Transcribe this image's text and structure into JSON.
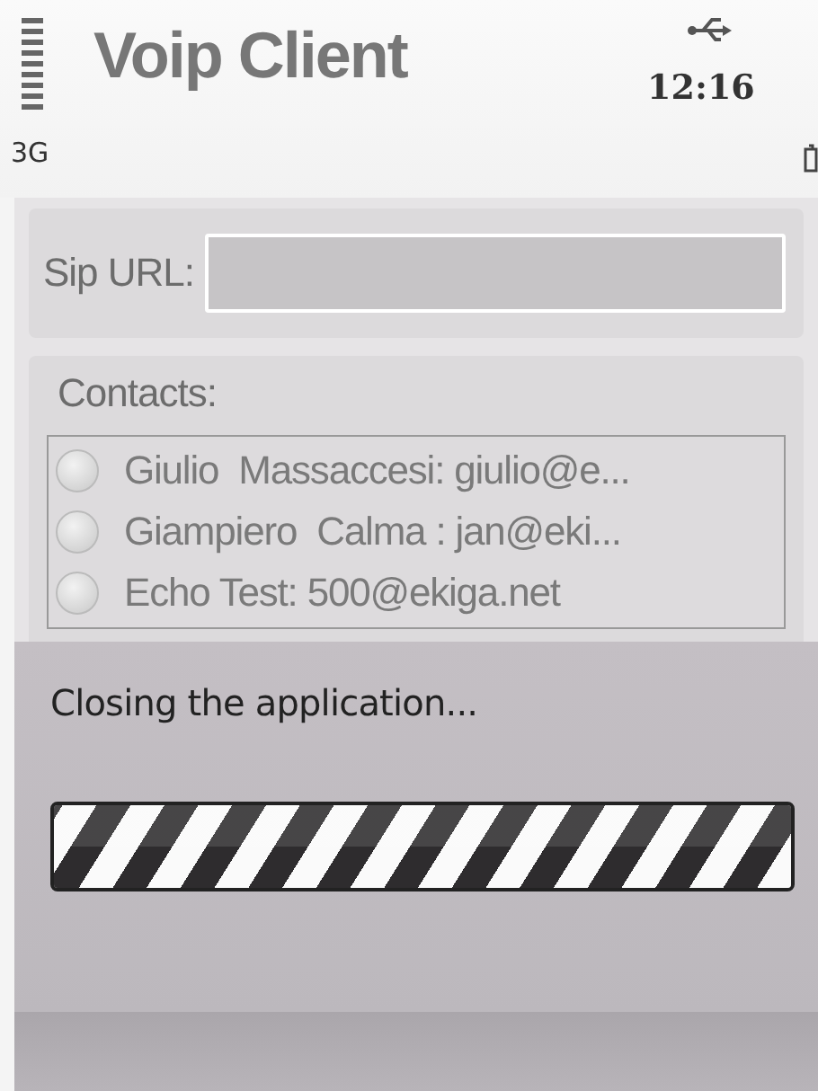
{
  "status_bar": {
    "title": "Voip Client",
    "network": "3G",
    "time": "12:16"
  },
  "sip": {
    "label": "Sip URL:"
  },
  "contacts": {
    "label": "Contacts:",
    "items": [
      {
        "text": "Giulio  Massaccesi: giulio@e...",
        "selected": false
      },
      {
        "text": "Giampiero  Calma : jan@eki...",
        "selected": false
      },
      {
        "text": "Echo Test: 500@ekiga.net",
        "selected": false
      }
    ]
  },
  "dialog": {
    "message": "Closing the application...",
    "progress": {
      "level": 1
    }
  }
}
